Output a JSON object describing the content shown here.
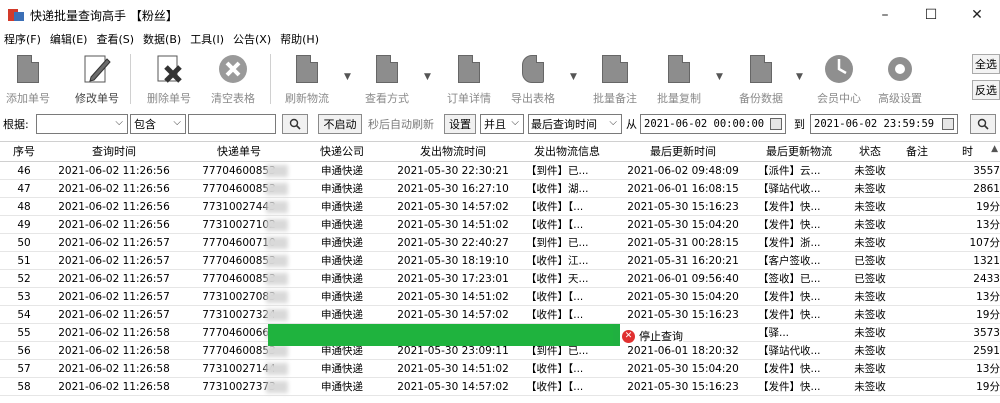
{
  "window": {
    "title": "快递批量查询高手 【粉丝】",
    "controls": [
      "–",
      "☐",
      "✕"
    ]
  },
  "menu": [
    "程序(F)",
    "编辑(E)",
    "查看(S)",
    "数据(B)",
    "工具(I)",
    "公告(X)",
    "帮助(H)"
  ],
  "toolbar": {
    "buttons": [
      {
        "label": "添加单号",
        "icon": "document-icon"
      },
      {
        "label": "修改单号",
        "icon": "edit-pencil-icon"
      },
      {
        "label": "删除单号",
        "icon": "delete-document-icon"
      },
      {
        "label": "清空表格",
        "icon": "clear-icon"
      },
      {
        "label": "刷新物流",
        "icon": "refresh-icon"
      },
      {
        "label": "查看方式",
        "icon": "view-icon"
      },
      {
        "label": "订单详情",
        "icon": "order-detail-icon"
      },
      {
        "label": "导出表格",
        "icon": "export-icon"
      },
      {
        "label": "批量备注",
        "icon": "note-icon"
      },
      {
        "label": "批量复制",
        "icon": "copy-icon"
      },
      {
        "label": "备份数据",
        "icon": "backup-icon"
      },
      {
        "label": "会员中心",
        "icon": "clock-icon"
      },
      {
        "label": "高级设置",
        "icon": "settings-icon"
      }
    ],
    "select_all": "全选",
    "invert_select": "反选"
  },
  "filter": {
    "basis_label": "根据:",
    "basis_value": "",
    "match_mode": "包含",
    "keyword": "",
    "auto_toggle": "不启动",
    "auto_refresh_text": "秒后自动刷新",
    "settings": "设置",
    "logic": "并且",
    "time_field": "最后查询时间",
    "from_label": "从",
    "from_value": "2021-06-02 00:00:00",
    "to_label": "到",
    "to_value": "2021-06-02 23:59:59"
  },
  "table": {
    "headers": [
      "序号",
      "查询时间",
      "快递单号",
      "快递公司",
      "发出物流时间",
      "发出物流信息",
      "最后更新时间",
      "最后更新物流",
      "状态",
      "备注",
      "时"
    ],
    "rows": [
      [
        "46",
        "2021-06-02 11:26:56",
        "77704600853",
        "申通快递",
        "2021-05-30 22:30:21",
        "【到件】已...",
        "2021-06-02 09:48:09",
        "【派件】云...",
        "未签收",
        "",
        "3557"
      ],
      [
        "47",
        "2021-06-02 11:26:56",
        "77704600853",
        "申通快递",
        "2021-05-30 16:27:10",
        "【收件】湖...",
        "2021-06-01 16:08:15",
        "【驿站代收...",
        "未签收",
        "",
        "2861"
      ],
      [
        "48",
        "2021-06-02 11:26:56",
        "77310027443",
        "申通快递",
        "2021-05-30 14:57:02",
        "【收件】【...",
        "2021-05-30 15:16:23",
        "【发件】快...",
        "未签收",
        "",
        "19分"
      ],
      [
        "49",
        "2021-06-02 11:26:56",
        "77310027102",
        "申通快递",
        "2021-05-30 14:51:02",
        "【收件】【...",
        "2021-05-30 15:04:20",
        "【发件】快...",
        "未签收",
        "",
        "13分"
      ],
      [
        "50",
        "2021-06-02 11:26:57",
        "77704600710",
        "申通快递",
        "2021-05-30 22:40:27",
        "【到件】已...",
        "2021-05-31 00:28:15",
        "【发件】浙...",
        "未签收",
        "",
        "107分"
      ],
      [
        "51",
        "2021-06-02 11:26:57",
        "77704600853",
        "申通快递",
        "2021-05-30 18:19:10",
        "【收件】江...",
        "2021-05-31 16:20:21",
        "【客户签收...",
        "已签收",
        "",
        "1321"
      ],
      [
        "52",
        "2021-06-02 11:26:57",
        "77704600853",
        "申通快递",
        "2021-05-30 17:23:01",
        "【收件】天...",
        "2021-06-01 09:56:40",
        "【签收】已...",
        "已签收",
        "",
        "2433"
      ],
      [
        "53",
        "2021-06-02 11:26:57",
        "77310027083",
        "申通快递",
        "2021-05-30 14:51:02",
        "【收件】【...",
        "2021-05-30 15:04:20",
        "【发件】快...",
        "未签收",
        "",
        "13分"
      ],
      [
        "54",
        "2021-06-02 11:26:57",
        "77310027324",
        "申通快递",
        "2021-05-30 14:57:02",
        "【收件】【...",
        "2021-05-30 15:16:23",
        "【发件】快...",
        "未签收",
        "",
        "19分"
      ],
      [
        "55",
        "2021-06-02 11:26:58",
        "77704600668",
        "",
        "",
        "",
        "",
        "【驿...",
        "未签收",
        "",
        "3573"
      ],
      [
        "56",
        "2021-06-02 11:26:58",
        "77704600853",
        "申通快递",
        "2021-05-30 23:09:11",
        "【到件】已...",
        "2021-06-01 18:20:32",
        "【驿站代收...",
        "未签收",
        "",
        "2591"
      ],
      [
        "57",
        "2021-06-02 11:26:58",
        "77310027144",
        "申通快递",
        "2021-05-30 14:51:02",
        "【收件】【...",
        "2021-05-30 15:04:20",
        "【发件】快...",
        "未签收",
        "",
        "13分"
      ],
      [
        "58",
        "2021-06-02 11:26:58",
        "77310027373",
        "申通快递",
        "2021-05-30 14:57:02",
        "【收件】【...",
        "2021-05-30 15:16:23",
        "【发件】快...",
        "未签收",
        "",
        "19分"
      ]
    ]
  },
  "progress": {
    "value": 0.98,
    "stop_label": "停止查询"
  }
}
